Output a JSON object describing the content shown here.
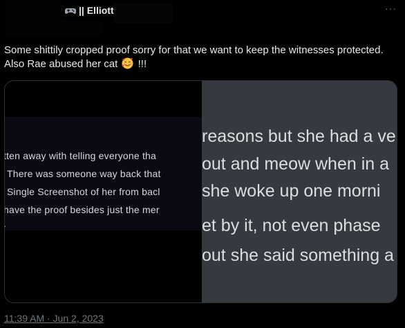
{
  "header": {
    "author_name": "|| Elliott",
    "more_label": "···"
  },
  "tweet": {
    "text_before_emoji": "Some shittily cropped proof sorry for that we want to keep the witnesses protected. Also Rae abused her cat",
    "emoji_name": "smiling-face-with-hearts",
    "text_after_emoji": "!!!",
    "timestamp": "11:39 AM · Jun 2, 2023"
  },
  "media": {
    "left_lines": [
      "tten away with telling everyone tha",
      "There was someone way back that",
      "Single Screenshot of her from bacl",
      "have the proof besides just the mer",
      "."
    ],
    "right_lines": [
      "reasons but she had a ve",
      "out and meow when in a",
      "she woke up one morni",
      "et by it, not even phase",
      "out she said something a"
    ]
  },
  "colors": {
    "background": "#000000",
    "text": "#e7e9ea",
    "muted": "#71767b",
    "discord_bg": "#36393f"
  }
}
